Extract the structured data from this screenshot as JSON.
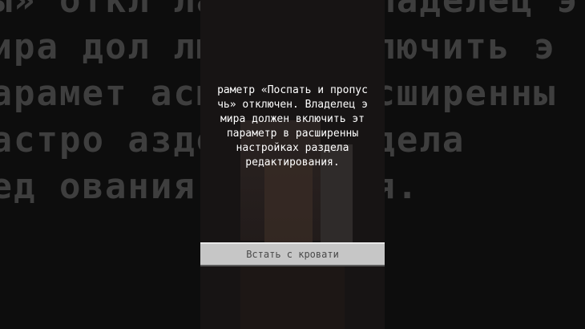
{
  "background_text": {
    "lines": [
      "лы» откл    ладелец э",
      "мира дол    лючить э",
      "парамет    асширенны",
      "настро    аздела",
      "ред    ования."
    ]
  },
  "message": {
    "lines": [
      "раметр «Поспать и пропус",
      "чь» отключен. Владелец э",
      "мира должен включить эт",
      "параметр в расширенны",
      "настройках раздела",
      "редактирования."
    ]
  },
  "wake_button": {
    "label": "Встать с кровати"
  }
}
